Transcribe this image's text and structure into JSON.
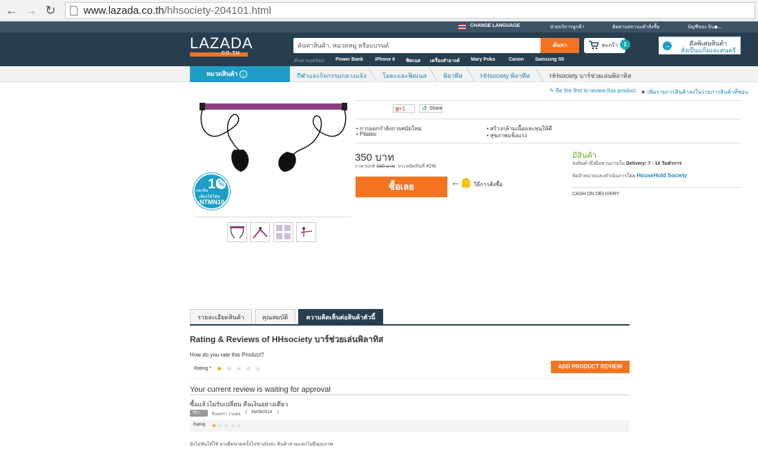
{
  "browser": {
    "url_host": "www.lazada.co.th",
    "url_path": "/hhsociety-204101.html"
  },
  "topbar": {
    "change_language": "CHANGE LANGUAGE",
    "customer_service": "ฝ่ายบริการลูกค้า",
    "track_order": "ติดตามสถานะคำสั่งซื้อ",
    "account": "บัญชีของ จิน◆..."
  },
  "header": {
    "logo_text": "LAZADA",
    "logo_sub": "CO.TH",
    "search_placeholder": "ค้นหาสินค้า, หมวดหมู่ หรือแบรนด์",
    "search_button": "ค้นหา",
    "popular_label": "ค้นหายอดนิยม",
    "popular": [
      "Power Bank",
      "iPhone 6",
      "ฟิตเนส",
      "เครื่องสำอางค์",
      "Mary Poko",
      "Canon",
      "Samsung S5"
    ],
    "cart_label": "ตะกร้า",
    "cart_count": "1",
    "promo_line1": "ดีลพิเศษสินค้า",
    "promo_line2": "สั่งเป็นแก๊งและคนครี"
  },
  "breadcrumb": {
    "category_button": "หมวดสินค้า",
    "items": [
      "กีฬาและกิจกรรมกลางแจ้ง",
      "โยคะและฟิตเนส",
      "พิลาทีส",
      "HHsociety พิลาทีส"
    ],
    "current": "HHsociety บาร์ช่วยเล่นพิลาทิส"
  },
  "product": {
    "first_review_link": "Be the first to review this product",
    "wishlist_link": "เพิ่มรายการสินค้าลงในรายการสินค้าที่ชอบ",
    "gplus": "+1",
    "share": "Share",
    "features": [
      "การออกกำลังกายสมัยใหม่",
      "Pilates",
      "สร้างกล้ามเนื้อและทุนให้ดี",
      "สุขภาพแข็งแรง"
    ],
    "price": "350 บาท",
    "regular_price_label": "ราคาปกติ",
    "regular_price": "590 บาท",
    "savings_label": "ประหยัดทันที",
    "savings": "41%",
    "buy_button": "ซื้อเลย",
    "how_to_order": "วิธีการสั่งซื้อ",
    "stock_status": "มีสินค้า",
    "delivery_label": "ส่งสินค้าถึงมือท่านภายใน",
    "delivery_value": "Delivery: 7 - 10 วันทำการ",
    "seller_label": "จัดจำหน่ายและดำเนินการโดย",
    "seller_name": "HouseHold Society",
    "payment": "CASH ON DELIVERY",
    "badge_discount": "10",
    "badge_percent": "%",
    "badge_line1": "ลดเพิ่ม",
    "badge_line2": "เพียงใช้โค้ด",
    "badge_code": "NTMN10"
  },
  "tabs": [
    "รายละเอียดสินค้า",
    "คุณสมบัติ",
    "ความคิดเห็นต่อสินค้าตัวนี้"
  ],
  "reviews": {
    "title": "Rating & Reviews of HHsociety บาร์ช่วยเล่นพิลาทิส",
    "rate_question": "How do you rate this Product?",
    "rating_label": "Rating *",
    "add_review_button": "ADD PRODUCT REVIEW",
    "waiting": "Your current review is waiting for approval",
    "review_title": "ซื้อแล้วไม่รับเปลี่ยน คืนเงินอย่างเดียว",
    "review_badge": "รีวิว",
    "reviewer": "จินตหรา งามยุข",
    "review_date": "26/09/2014",
    "review_rating_label": "Rating",
    "review_text": "ยังไม่ทันได้ใช้ ยางยืดขาดครั้งไปช่างบิงล่ะ สินค้าห่วยแตกไม่มีคุณภาพ"
  },
  "colors": {
    "header_dark": "#273e4f",
    "accent_orange": "#f47321",
    "accent_blue": "#1e9ec6",
    "stock_green": "#6aaa2e"
  }
}
